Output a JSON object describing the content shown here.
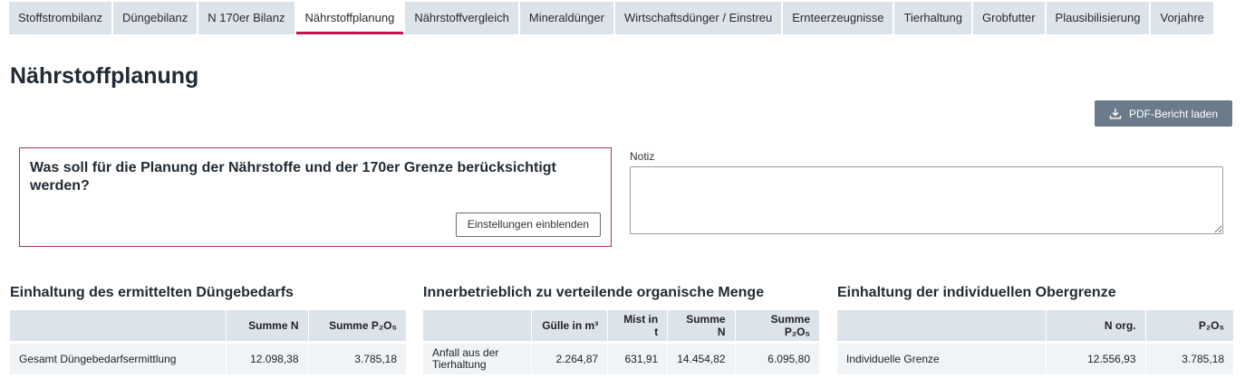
{
  "tabs": [
    {
      "label": "Stoffstrombilanz",
      "active": false
    },
    {
      "label": "Düngebilanz",
      "active": false
    },
    {
      "label": "N 170er Bilanz",
      "active": false
    },
    {
      "label": "Nährstoffplanung",
      "active": true
    },
    {
      "label": "Nährstoffvergleich",
      "active": false
    },
    {
      "label": "Mineraldünger",
      "active": false
    },
    {
      "label": "Wirtschaftsdünger / Einstreu",
      "active": false
    },
    {
      "label": "Ernteerzeugnisse",
      "active": false
    },
    {
      "label": "Tierhaltung",
      "active": false
    },
    {
      "label": "Grobfutter",
      "active": false
    },
    {
      "label": "Plausibilisierung",
      "active": false
    },
    {
      "label": "Vorjahre",
      "active": false
    }
  ],
  "page": {
    "title": "Nährstoffplanung",
    "pdf_button": "PDF-Bericht laden"
  },
  "settings": {
    "question": "Was soll für die Planung der Nährstoffe und der 170er Grenze berücksichtigt werden?",
    "button": "Einstellungen einblenden"
  },
  "notiz": {
    "label": "Notiz",
    "value": ""
  },
  "table1": {
    "title": "Einhaltung des ermittelten Düngebedarfs",
    "headers": [
      "",
      "Summe N",
      "Summe P₂O₅"
    ],
    "rows": [
      [
        "Gesamt Düngebedarfsermittlung",
        "12.098,38",
        "3.785,18"
      ]
    ]
  },
  "table2": {
    "title": "Innerbetrieblich zu verteilende organische Menge",
    "headers": [
      "",
      "Gülle in m³",
      "Mist in t",
      "Summe N",
      "Summe P₂O₅"
    ],
    "rows": [
      [
        "Anfall aus der Tierhaltung",
        "2.264,87",
        "631,91",
        "14.454,82",
        "6.095,80"
      ]
    ]
  },
  "table3": {
    "title": "Einhaltung der individuellen Obergrenze",
    "headers": [
      "",
      "N org.",
      "P₂O₅"
    ],
    "rows": [
      [
        "Individuelle Grenze",
        "12.556,93",
        "3.785,18"
      ]
    ]
  },
  "icons": {
    "pdf_button_icon": "download-icon"
  },
  "colors": {
    "accent": "#c0134f",
    "tab_bg": "#dce3ea",
    "button_bg": "#6c7b8b"
  }
}
